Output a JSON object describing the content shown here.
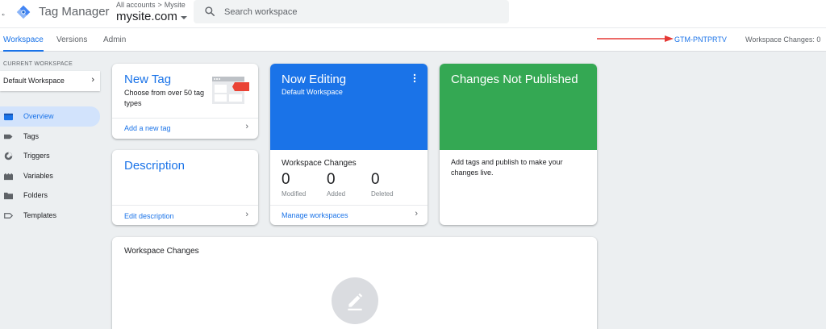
{
  "app": {
    "back_glyph": "←",
    "title": "Tag Manager",
    "breadcrumb": [
      "All accounts",
      ">",
      "Mysite"
    ],
    "container_name": "mysite.com",
    "brand_color": "#1a73e8"
  },
  "search": {
    "placeholder": "Search workspace"
  },
  "tabs": [
    {
      "label": "Workspace",
      "active": true
    },
    {
      "label": "Versions",
      "active": false
    },
    {
      "label": "Admin",
      "active": false
    }
  ],
  "header_right": {
    "container_id": "GTM-PNTPRTV",
    "workspace_changes": "Workspace Changes: 0",
    "annotation_arrow_color": "#e53935"
  },
  "sidebar": {
    "current_workspace_label": "CURRENT WORKSPACE",
    "workspace_name": "Default Workspace",
    "items": [
      {
        "label": "Overview",
        "icon": "overview-icon",
        "active": true
      },
      {
        "label": "Tags",
        "icon": "tag-icon",
        "active": false
      },
      {
        "label": "Triggers",
        "icon": "trigger-icon",
        "active": false
      },
      {
        "label": "Variables",
        "icon": "variables-icon",
        "active": false
      },
      {
        "label": "Folders",
        "icon": "folder-icon",
        "active": false
      },
      {
        "label": "Templates",
        "icon": "template-icon",
        "active": false
      }
    ]
  },
  "cards": {
    "new_tag": {
      "title": "New Tag",
      "body": "Choose from over 50 tag types",
      "link": "Add a new tag",
      "icon": "tag-illustration-icon"
    },
    "description": {
      "title": "Description",
      "link": "Edit description"
    },
    "now_editing": {
      "title": "Now Editing",
      "subtitle": "Default Workspace",
      "changes_label": "Workspace Changes",
      "stats": [
        {
          "value": "0",
          "label": "Modified"
        },
        {
          "value": "0",
          "label": "Added"
        },
        {
          "value": "0",
          "label": "Deleted"
        }
      ],
      "link": "Manage workspaces",
      "color": "#1a73e8"
    },
    "not_published": {
      "title": "Changes Not Published",
      "body": "Add tags and publish to make your changes live.",
      "color": "#34a853"
    },
    "workspace_changes": {
      "title": "Workspace Changes",
      "icon": "edit-pencil-icon"
    }
  }
}
